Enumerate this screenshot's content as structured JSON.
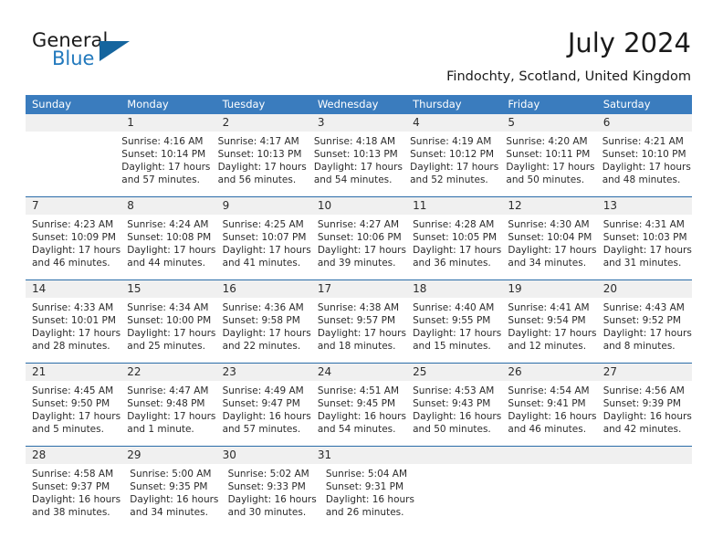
{
  "brand": {
    "name_part1": "General",
    "name_part2": "Blue",
    "logo_icon": "triangle-logo-icon",
    "accent_color": "#15659e"
  },
  "header": {
    "title": "July 2024",
    "location": "Findochty, Scotland, United Kingdom"
  },
  "calendar": {
    "header_color": "#3a7cbe",
    "daynum_band_color": "#f0f0f0",
    "row_separator_color": "#2a6ca8",
    "weekdays": [
      "Sunday",
      "Monday",
      "Tuesday",
      "Wednesday",
      "Thursday",
      "Friday",
      "Saturday"
    ],
    "weeks": [
      {
        "days": [
          {
            "empty": true
          },
          {
            "date": "1",
            "sunrise": "Sunrise: 4:16 AM",
            "sunset": "Sunset: 10:14 PM",
            "daylight_line1": "Daylight: 17 hours",
            "daylight_line2": "and 57 minutes."
          },
          {
            "date": "2",
            "sunrise": "Sunrise: 4:17 AM",
            "sunset": "Sunset: 10:13 PM",
            "daylight_line1": "Daylight: 17 hours",
            "daylight_line2": "and 56 minutes."
          },
          {
            "date": "3",
            "sunrise": "Sunrise: 4:18 AM",
            "sunset": "Sunset: 10:13 PM",
            "daylight_line1": "Daylight: 17 hours",
            "daylight_line2": "and 54 minutes."
          },
          {
            "date": "4",
            "sunrise": "Sunrise: 4:19 AM",
            "sunset": "Sunset: 10:12 PM",
            "daylight_line1": "Daylight: 17 hours",
            "daylight_line2": "and 52 minutes."
          },
          {
            "date": "5",
            "sunrise": "Sunrise: 4:20 AM",
            "sunset": "Sunset: 10:11 PM",
            "daylight_line1": "Daylight: 17 hours",
            "daylight_line2": "and 50 minutes."
          },
          {
            "date": "6",
            "sunrise": "Sunrise: 4:21 AM",
            "sunset": "Sunset: 10:10 PM",
            "daylight_line1": "Daylight: 17 hours",
            "daylight_line2": "and 48 minutes."
          }
        ]
      },
      {
        "days": [
          {
            "date": "7",
            "sunrise": "Sunrise: 4:23 AM",
            "sunset": "Sunset: 10:09 PM",
            "daylight_line1": "Daylight: 17 hours",
            "daylight_line2": "and 46 minutes."
          },
          {
            "date": "8",
            "sunrise": "Sunrise: 4:24 AM",
            "sunset": "Sunset: 10:08 PM",
            "daylight_line1": "Daylight: 17 hours",
            "daylight_line2": "and 44 minutes."
          },
          {
            "date": "9",
            "sunrise": "Sunrise: 4:25 AM",
            "sunset": "Sunset: 10:07 PM",
            "daylight_line1": "Daylight: 17 hours",
            "daylight_line2": "and 41 minutes."
          },
          {
            "date": "10",
            "sunrise": "Sunrise: 4:27 AM",
            "sunset": "Sunset: 10:06 PM",
            "daylight_line1": "Daylight: 17 hours",
            "daylight_line2": "and 39 minutes."
          },
          {
            "date": "11",
            "sunrise": "Sunrise: 4:28 AM",
            "sunset": "Sunset: 10:05 PM",
            "daylight_line1": "Daylight: 17 hours",
            "daylight_line2": "and 36 minutes."
          },
          {
            "date": "12",
            "sunrise": "Sunrise: 4:30 AM",
            "sunset": "Sunset: 10:04 PM",
            "daylight_line1": "Daylight: 17 hours",
            "daylight_line2": "and 34 minutes."
          },
          {
            "date": "13",
            "sunrise": "Sunrise: 4:31 AM",
            "sunset": "Sunset: 10:03 PM",
            "daylight_line1": "Daylight: 17 hours",
            "daylight_line2": "and 31 minutes."
          }
        ]
      },
      {
        "days": [
          {
            "date": "14",
            "sunrise": "Sunrise: 4:33 AM",
            "sunset": "Sunset: 10:01 PM",
            "daylight_line1": "Daylight: 17 hours",
            "daylight_line2": "and 28 minutes."
          },
          {
            "date": "15",
            "sunrise": "Sunrise: 4:34 AM",
            "sunset": "Sunset: 10:00 PM",
            "daylight_line1": "Daylight: 17 hours",
            "daylight_line2": "and 25 minutes."
          },
          {
            "date": "16",
            "sunrise": "Sunrise: 4:36 AM",
            "sunset": "Sunset: 9:58 PM",
            "daylight_line1": "Daylight: 17 hours",
            "daylight_line2": "and 22 minutes."
          },
          {
            "date": "17",
            "sunrise": "Sunrise: 4:38 AM",
            "sunset": "Sunset: 9:57 PM",
            "daylight_line1": "Daylight: 17 hours",
            "daylight_line2": "and 18 minutes."
          },
          {
            "date": "18",
            "sunrise": "Sunrise: 4:40 AM",
            "sunset": "Sunset: 9:55 PM",
            "daylight_line1": "Daylight: 17 hours",
            "daylight_line2": "and 15 minutes."
          },
          {
            "date": "19",
            "sunrise": "Sunrise: 4:41 AM",
            "sunset": "Sunset: 9:54 PM",
            "daylight_line1": "Daylight: 17 hours",
            "daylight_line2": "and 12 minutes."
          },
          {
            "date": "20",
            "sunrise": "Sunrise: 4:43 AM",
            "sunset": "Sunset: 9:52 PM",
            "daylight_line1": "Daylight: 17 hours",
            "daylight_line2": "and 8 minutes."
          }
        ]
      },
      {
        "days": [
          {
            "date": "21",
            "sunrise": "Sunrise: 4:45 AM",
            "sunset": "Sunset: 9:50 PM",
            "daylight_line1": "Daylight: 17 hours",
            "daylight_line2": "and 5 minutes."
          },
          {
            "date": "22",
            "sunrise": "Sunrise: 4:47 AM",
            "sunset": "Sunset: 9:48 PM",
            "daylight_line1": "Daylight: 17 hours",
            "daylight_line2": "and 1 minute."
          },
          {
            "date": "23",
            "sunrise": "Sunrise: 4:49 AM",
            "sunset": "Sunset: 9:47 PM",
            "daylight_line1": "Daylight: 16 hours",
            "daylight_line2": "and 57 minutes."
          },
          {
            "date": "24",
            "sunrise": "Sunrise: 4:51 AM",
            "sunset": "Sunset: 9:45 PM",
            "daylight_line1": "Daylight: 16 hours",
            "daylight_line2": "and 54 minutes."
          },
          {
            "date": "25",
            "sunrise": "Sunrise: 4:53 AM",
            "sunset": "Sunset: 9:43 PM",
            "daylight_line1": "Daylight: 16 hours",
            "daylight_line2": "and 50 minutes."
          },
          {
            "date": "26",
            "sunrise": "Sunrise: 4:54 AM",
            "sunset": "Sunset: 9:41 PM",
            "daylight_line1": "Daylight: 16 hours",
            "daylight_line2": "and 46 minutes."
          },
          {
            "date": "27",
            "sunrise": "Sunrise: 4:56 AM",
            "sunset": "Sunset: 9:39 PM",
            "daylight_line1": "Daylight: 16 hours",
            "daylight_line2": "and 42 minutes."
          }
        ]
      },
      {
        "days": [
          {
            "date": "28",
            "sunrise": "Sunrise: 4:58 AM",
            "sunset": "Sunset: 9:37 PM",
            "daylight_line1": "Daylight: 16 hours",
            "daylight_line2": "and 38 minutes."
          },
          {
            "date": "29",
            "sunrise": "Sunrise: 5:00 AM",
            "sunset": "Sunset: 9:35 PM",
            "daylight_line1": "Daylight: 16 hours",
            "daylight_line2": "and 34 minutes."
          },
          {
            "date": "30",
            "sunrise": "Sunrise: 5:02 AM",
            "sunset": "Sunset: 9:33 PM",
            "daylight_line1": "Daylight: 16 hours",
            "daylight_line2": "and 30 minutes."
          },
          {
            "date": "31",
            "sunrise": "Sunrise: 5:04 AM",
            "sunset": "Sunset: 9:31 PM",
            "daylight_line1": "Daylight: 16 hours",
            "daylight_line2": "and 26 minutes."
          },
          {
            "empty": true
          },
          {
            "empty": true
          },
          {
            "empty": true
          }
        ]
      }
    ]
  }
}
